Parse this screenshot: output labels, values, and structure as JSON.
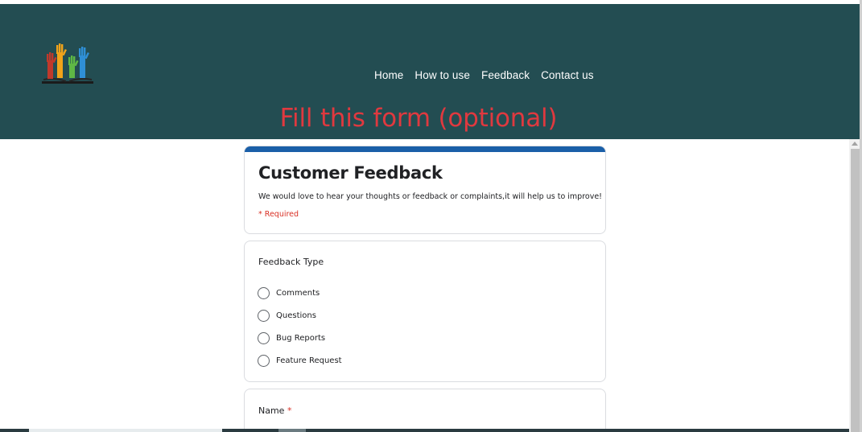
{
  "nav": {
    "items": [
      "Home",
      "How to use",
      "Feedback",
      "Contact us"
    ]
  },
  "banner": {
    "text": "Fill this form (optional)"
  },
  "form": {
    "title": "Customer Feedback",
    "description": "We would love to hear your thoughts or feedback or complaints,it will help us to improve!",
    "required_note": "* Required"
  },
  "question_feedback_type": {
    "label": "Feedback Type",
    "options": [
      "Comments",
      "Questions",
      "Bug Reports",
      "Feature Request"
    ]
  },
  "question_name": {
    "label": "Name",
    "required_marker": "*"
  },
  "colors": {
    "header_bg": "#234d52",
    "banner_text": "#e0393f",
    "form_accent": "#1a5fa8",
    "required": "#d93025"
  },
  "icons": {
    "logo": "raised-hands-logo-icon"
  }
}
